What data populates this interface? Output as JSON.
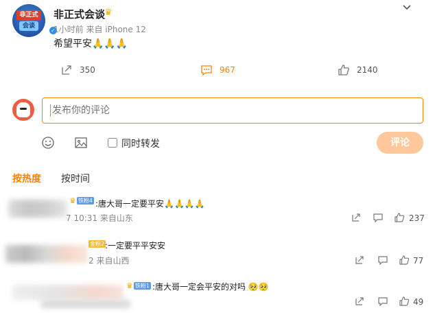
{
  "post": {
    "username": "非正式会谈",
    "avatar_top": "非正式",
    "avatar_bottom": "会谈",
    "time": "1小时前",
    "source": "来自 iPhone 12",
    "text": "希望平安🙏🙏🙏",
    "repost_count": "350",
    "comment_count": "967",
    "like_count": "2140"
  },
  "composer": {
    "placeholder": "发布你的评论",
    "forward_label": "同时转发",
    "submit_label": "评论"
  },
  "sort": {
    "hot_label": "按热度",
    "time_label": "按时间"
  },
  "comments": [
    {
      "badge": "铁粉4",
      "text": ":唐大哥一定要平安🙏🙏🙏🙏",
      "meta": "7 10:31 来自山东",
      "like_count": "237"
    },
    {
      "badge": "金粉2",
      "text": ":一定要平平安安",
      "meta": "2 来自山西",
      "like_count": "77"
    },
    {
      "badge": "铁粉1",
      "text": ":唐大哥一定会平安的对吗 🥺🥺",
      "meta": "",
      "like_count": "49"
    }
  ],
  "colors": {
    "accent": "#ff8200",
    "submit_bg": "#ffc89a",
    "verified": "#2d8cf0"
  }
}
